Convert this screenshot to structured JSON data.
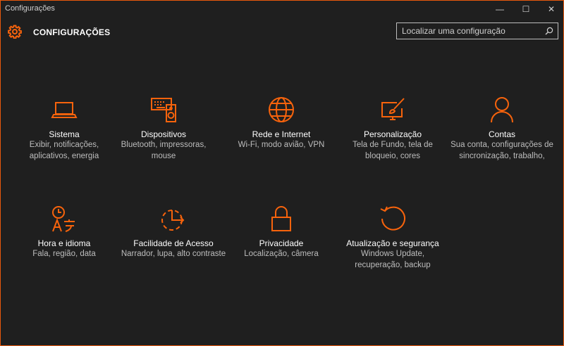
{
  "window": {
    "title": "Configurações",
    "accent": "#f7630c"
  },
  "title_controls": {
    "minimize": "—",
    "maximize": "☐",
    "close": "✕"
  },
  "header": {
    "title": "CONFIGURAÇÕES"
  },
  "search": {
    "placeholder": "Localizar uma configuração"
  },
  "categories": [
    {
      "label": "Sistema",
      "description": "Exibir, notificações, aplicativos, energia",
      "icon": "laptop-icon"
    },
    {
      "label": "Dispositivos",
      "description": "Bluetooth, impressoras, mouse",
      "icon": "devices-icon"
    },
    {
      "label": "Rede e Internet",
      "description": "Wi-Fi, modo avião, VPN",
      "icon": "globe-icon"
    },
    {
      "label": "Personalização",
      "description": "Tela de Fundo, tela de bloqueio, cores",
      "icon": "paint-icon"
    },
    {
      "label": "Contas",
      "description": "Sua conta, configurações de sincronização, trabalho,",
      "icon": "person-icon"
    },
    {
      "label": "Hora e idioma",
      "description": "Fala, região, data",
      "icon": "time-language-icon"
    },
    {
      "label": "Facilidade de Acesso",
      "description": "Narrador, lupa, alto contraste",
      "icon": "ease-of-access-icon"
    },
    {
      "label": "Privacidade",
      "description": "Localização, câmera",
      "icon": "lock-icon"
    },
    {
      "label": "Atualização e segurança",
      "description": "Windows Update, recuperação, backup",
      "icon": "update-icon"
    }
  ]
}
